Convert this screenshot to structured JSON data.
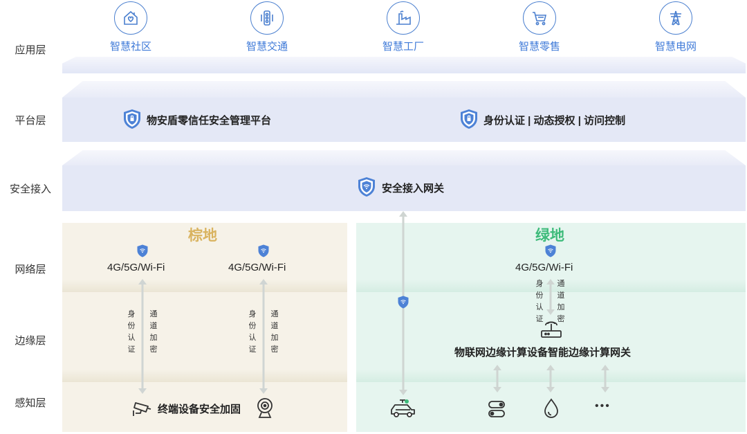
{
  "layers": [
    "应用层",
    "平台层",
    "安全接入",
    "网络层",
    "边缘层",
    "感知层"
  ],
  "apps": [
    {
      "name": "智慧社区",
      "icon": "house-heart-icon"
    },
    {
      "name": "智慧交通",
      "icon": "traffic-light-icon"
    },
    {
      "name": "智慧工厂",
      "icon": "factory-icon"
    },
    {
      "name": "智慧零售",
      "icon": "shopping-cart-icon"
    },
    {
      "name": "智慧电网",
      "icon": "power-tower-icon"
    }
  ],
  "platform": {
    "left_label": "物安盾零信任安全管理平台",
    "right_label": "身份认证 | 动态授权 | 访问控制"
  },
  "access": {
    "label": "安全接入网关"
  },
  "brownfield": {
    "title": "棕地",
    "network_left": "4G/5G/Wi-Fi",
    "network_right": "4G/5G/Wi-Fi",
    "auth_left": "身份认证",
    "enc_left": "通道加密",
    "auth_right": "身份认证",
    "enc_right": "通道加密",
    "device_label": "终端设备安全加固"
  },
  "greenfield": {
    "title": "绿地",
    "network": "4G/5G/Wi-Fi",
    "auth": "身份认证",
    "enc": "通道加密",
    "edge_label": "物联网边缘计算设备智能边缘计算网关",
    "more": "•••"
  },
  "colors": {
    "accent_blue": "#3f7ad8",
    "brown_title": "#d9b35f",
    "green_title": "#3dbb7a",
    "brown_bg": "#f6f2e8",
    "green_bg": "#e6f5ef",
    "band_bg": "#e4e8f6"
  }
}
